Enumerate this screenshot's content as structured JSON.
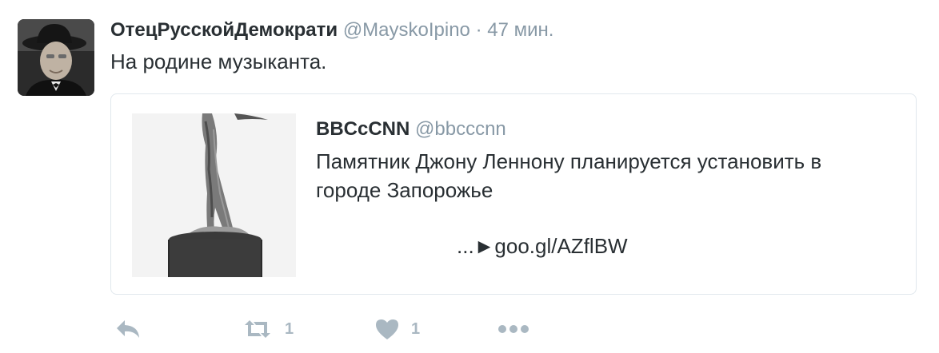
{
  "tweet": {
    "author_name": "ОтецРусскойДемократи",
    "author_handle": "@MayskoIpino",
    "separator": "·",
    "time": "47 мин.",
    "text": "На родине музыканта.",
    "avatar_icon": "user-avatar-photo"
  },
  "quote": {
    "author_name": "BBCcCNN",
    "author_handle": "@bbcccnn",
    "text": "Памятник Джону Леннону планируется установить в городе Запорожье",
    "link": "...►goo.gl/AZflBW",
    "media_icon": "sculpture-photo"
  },
  "actions": {
    "reply_icon": "reply-icon",
    "retweet_icon": "retweet-icon",
    "retweet_count": "1",
    "like_icon": "heart-icon",
    "like_count": "1",
    "more_icon": "more-dots-icon"
  },
  "colors": {
    "text": "#292f33",
    "muted": "#8899a6",
    "action": "#aab8c2",
    "border": "#e1e8ed"
  }
}
